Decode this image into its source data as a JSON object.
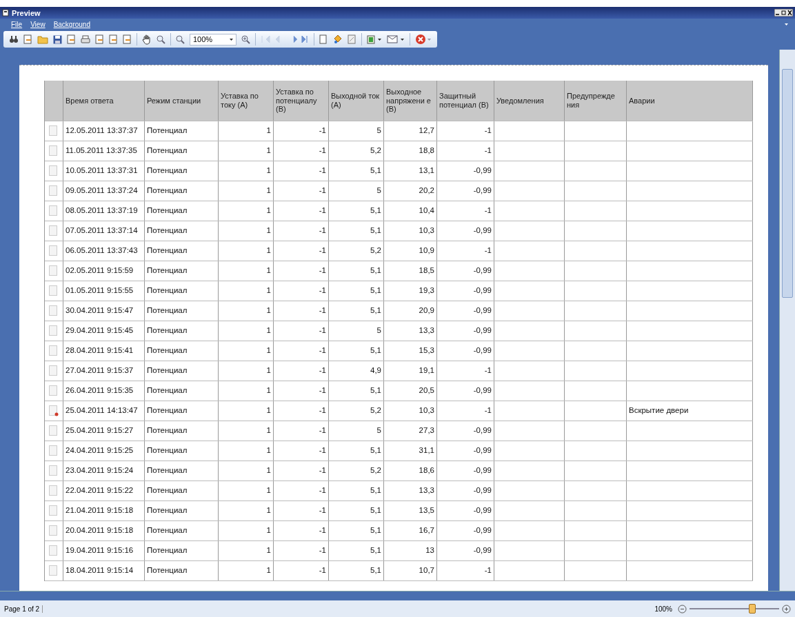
{
  "window": {
    "title": "Preview"
  },
  "menu": [
    {
      "label": "File"
    },
    {
      "label": "View"
    },
    {
      "label": "Background"
    }
  ],
  "toolbar": {
    "zoom": "100%"
  },
  "table": {
    "columns": [
      "Время ответа",
      "Режим станции",
      "Уставка по току (А)",
      "Уставка по потенциалу (В)",
      "Выходной ток (А)",
      "Выходное напряжени е (В)",
      "Защитный потенциал (В)",
      "Уведомления",
      "Предупрежде ния",
      "Аварии"
    ],
    "rows": [
      {
        "flagged": false,
        "cells": [
          "12.05.2011 13:37:37",
          "Потенциал",
          "1",
          "-1",
          "5",
          "12,7",
          "-1",
          "",
          "",
          ""
        ]
      },
      {
        "flagged": false,
        "cells": [
          "11.05.2011 13:37:35",
          "Потенциал",
          "1",
          "-1",
          "5,2",
          "18,8",
          "-1",
          "",
          "",
          ""
        ]
      },
      {
        "flagged": false,
        "cells": [
          "10.05.2011 13:37:31",
          "Потенциал",
          "1",
          "-1",
          "5,1",
          "13,1",
          "-0,99",
          "",
          "",
          ""
        ]
      },
      {
        "flagged": false,
        "cells": [
          "09.05.2011 13:37:24",
          "Потенциал",
          "1",
          "-1",
          "5",
          "20,2",
          "-0,99",
          "",
          "",
          ""
        ]
      },
      {
        "flagged": false,
        "cells": [
          "08.05.2011 13:37:19",
          "Потенциал",
          "1",
          "-1",
          "5,1",
          "10,4",
          "-1",
          "",
          "",
          ""
        ]
      },
      {
        "flagged": false,
        "cells": [
          "07.05.2011 13:37:14",
          "Потенциал",
          "1",
          "-1",
          "5,1",
          "10,3",
          "-0,99",
          "",
          "",
          ""
        ]
      },
      {
        "flagged": false,
        "cells": [
          "06.05.2011 13:37:43",
          "Потенциал",
          "1",
          "-1",
          "5,2",
          "10,9",
          "-1",
          "",
          "",
          ""
        ]
      },
      {
        "flagged": false,
        "cells": [
          "02.05.2011 9:15:59",
          "Потенциал",
          "1",
          "-1",
          "5,1",
          "18,5",
          "-0,99",
          "",
          "",
          ""
        ]
      },
      {
        "flagged": false,
        "cells": [
          "01.05.2011 9:15:55",
          "Потенциал",
          "1",
          "-1",
          "5,1",
          "19,3",
          "-0,99",
          "",
          "",
          ""
        ]
      },
      {
        "flagged": false,
        "cells": [
          "30.04.2011 9:15:47",
          "Потенциал",
          "1",
          "-1",
          "5,1",
          "20,9",
          "-0,99",
          "",
          "",
          ""
        ]
      },
      {
        "flagged": false,
        "cells": [
          "29.04.2011 9:15:45",
          "Потенциал",
          "1",
          "-1",
          "5",
          "13,3",
          "-0,99",
          "",
          "",
          ""
        ]
      },
      {
        "flagged": false,
        "cells": [
          "28.04.2011 9:15:41",
          "Потенциал",
          "1",
          "-1",
          "5,1",
          "15,3",
          "-0,99",
          "",
          "",
          ""
        ]
      },
      {
        "flagged": false,
        "cells": [
          "27.04.2011 9:15:37",
          "Потенциал",
          "1",
          "-1",
          "4,9",
          "19,1",
          "-1",
          "",
          "",
          ""
        ]
      },
      {
        "flagged": false,
        "cells": [
          "26.04.2011 9:15:35",
          "Потенциал",
          "1",
          "-1",
          "5,1",
          "20,5",
          "-0,99",
          "",
          "",
          ""
        ]
      },
      {
        "flagged": true,
        "cells": [
          "25.04.2011 14:13:47",
          "Потенциал",
          "1",
          "-1",
          "5,2",
          "10,3",
          "-1",
          "",
          "",
          "Вскрытие двери"
        ]
      },
      {
        "flagged": false,
        "cells": [
          "25.04.2011 9:15:27",
          "Потенциал",
          "1",
          "-1",
          "5",
          "27,3",
          "-0,99",
          "",
          "",
          ""
        ]
      },
      {
        "flagged": false,
        "cells": [
          "24.04.2011 9:15:25",
          "Потенциал",
          "1",
          "-1",
          "5,1",
          "31,1",
          "-0,99",
          "",
          "",
          ""
        ]
      },
      {
        "flagged": false,
        "cells": [
          "23.04.2011 9:15:24",
          "Потенциал",
          "1",
          "-1",
          "5,2",
          "18,6",
          "-0,99",
          "",
          "",
          ""
        ]
      },
      {
        "flagged": false,
        "cells": [
          "22.04.2011 9:15:22",
          "Потенциал",
          "1",
          "-1",
          "5,1",
          "13,3",
          "-0,99",
          "",
          "",
          ""
        ]
      },
      {
        "flagged": false,
        "cells": [
          "21.04.2011 9:15:18",
          "Потенциал",
          "1",
          "-1",
          "5,1",
          "13,5",
          "-0,99",
          "",
          "",
          ""
        ]
      },
      {
        "flagged": false,
        "cells": [
          "20.04.2011 9:15:18",
          "Потенциал",
          "1",
          "-1",
          "5,1",
          "16,7",
          "-0,99",
          "",
          "",
          ""
        ]
      },
      {
        "flagged": false,
        "cells": [
          "19.04.2011 9:15:16",
          "Потенциал",
          "1",
          "-1",
          "5,1",
          "13",
          "-0,99",
          "",
          "",
          ""
        ]
      },
      {
        "flagged": false,
        "cells": [
          "18.04.2011 9:15:14",
          "Потенциал",
          "1",
          "-1",
          "5,1",
          "10,7",
          "-1",
          "",
          "",
          ""
        ]
      }
    ]
  },
  "status_bar": {
    "page": "Page 1 of 2",
    "zoom": "100%",
    "level": 0.7
  }
}
